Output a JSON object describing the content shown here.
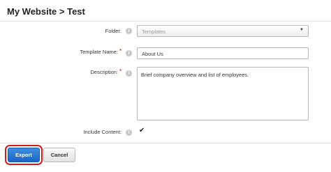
{
  "page": {
    "title": "My Website > Test"
  },
  "form": {
    "folder": {
      "label": "Folder:",
      "value": "Templates"
    },
    "template_name": {
      "label": "Template Name:",
      "required_mark": "*",
      "value": "About Us"
    },
    "description": {
      "label": "Description:",
      "required_mark": "*",
      "value": "Brief company overview and list of employees."
    },
    "include_content": {
      "label": "Include Content:",
      "checked": true,
      "check_glyph": "✔"
    },
    "info_icon": "i"
  },
  "actions": {
    "export_label": "Export",
    "cancel_label": "Cancel"
  },
  "colors": {
    "accent": "#1c65c8",
    "highlight": "#d21a1a",
    "required": "#cc0000"
  }
}
